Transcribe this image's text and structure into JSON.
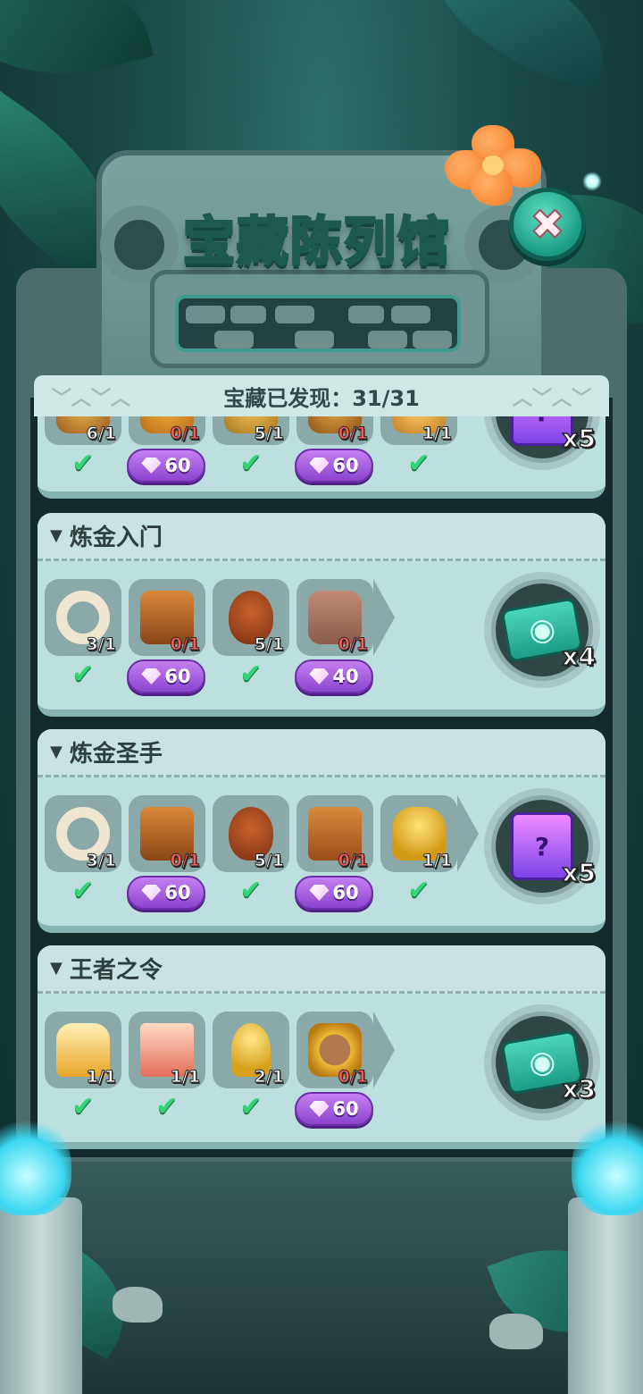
{
  "window": {
    "title": "宝藏陈列馆",
    "close_label": "✖"
  },
  "progress": {
    "text": "宝藏已发现：31/31"
  },
  "sections": [
    {
      "title": "",
      "items": [
        {
          "icon": "treasure-icon",
          "count": "6/1",
          "status": "owned"
        },
        {
          "icon": "treasure-icon",
          "count": "0/1",
          "status": "price",
          "price": "60"
        },
        {
          "icon": "treasure-icon",
          "count": "5/1",
          "status": "owned"
        },
        {
          "icon": "treasure-icon",
          "count": "0/1",
          "status": "price",
          "price": "60"
        },
        {
          "icon": "treasure-icon",
          "count": "1/1",
          "status": "owned"
        }
      ],
      "reward": {
        "icon": "mystery-ticket-icon",
        "mult": "x5"
      }
    },
    {
      "title": "炼金入门",
      "items": [
        {
          "icon": "bone-ring-icon",
          "count": "3/1",
          "status": "owned"
        },
        {
          "icon": "tiki-mask-icon",
          "count": "0/1",
          "status": "price",
          "price": "60"
        },
        {
          "icon": "tribal-shield-icon",
          "count": "5/1",
          "status": "owned"
        },
        {
          "icon": "stone-tablet-icon",
          "count": "0/1",
          "status": "price",
          "price": "40"
        }
      ],
      "reward": {
        "icon": "eye-ticket-icon",
        "mult": "x4"
      }
    },
    {
      "title": "炼金圣手",
      "items": [
        {
          "icon": "bone-ring-icon",
          "count": "3/1",
          "status": "owned"
        },
        {
          "icon": "tiki-mask-icon",
          "count": "0/1",
          "status": "price",
          "price": "60"
        },
        {
          "icon": "tribal-shield-icon",
          "count": "5/1",
          "status": "owned"
        },
        {
          "icon": "ancient-book-icon",
          "count": "0/1",
          "status": "price",
          "price": "60"
        },
        {
          "icon": "gold-trophy-icon",
          "count": "1/1",
          "status": "owned"
        }
      ],
      "reward": {
        "icon": "mystery-ticket-icon",
        "mult": "x5"
      }
    },
    {
      "title": "王者之令",
      "items": [
        {
          "icon": "golden-crown-icon",
          "count": "1/1",
          "status": "owned"
        },
        {
          "icon": "royal-scroll-icon",
          "count": "1/1",
          "status": "owned"
        },
        {
          "icon": "golden-scepter-icon",
          "count": "2/1",
          "status": "owned"
        },
        {
          "icon": "gold-medal-icon",
          "count": "0/1",
          "status": "price",
          "price": "60"
        }
      ],
      "reward": {
        "icon": "eye-ticket-icon",
        "mult": "x3"
      }
    }
  ],
  "colors": {
    "card": "#bde0df",
    "tile": "#8aa9a8",
    "price_purple": "#9a55dd",
    "check_green": "#35d27a",
    "count_red": "#ff5b5b",
    "title_mint": "#d9fff0"
  }
}
